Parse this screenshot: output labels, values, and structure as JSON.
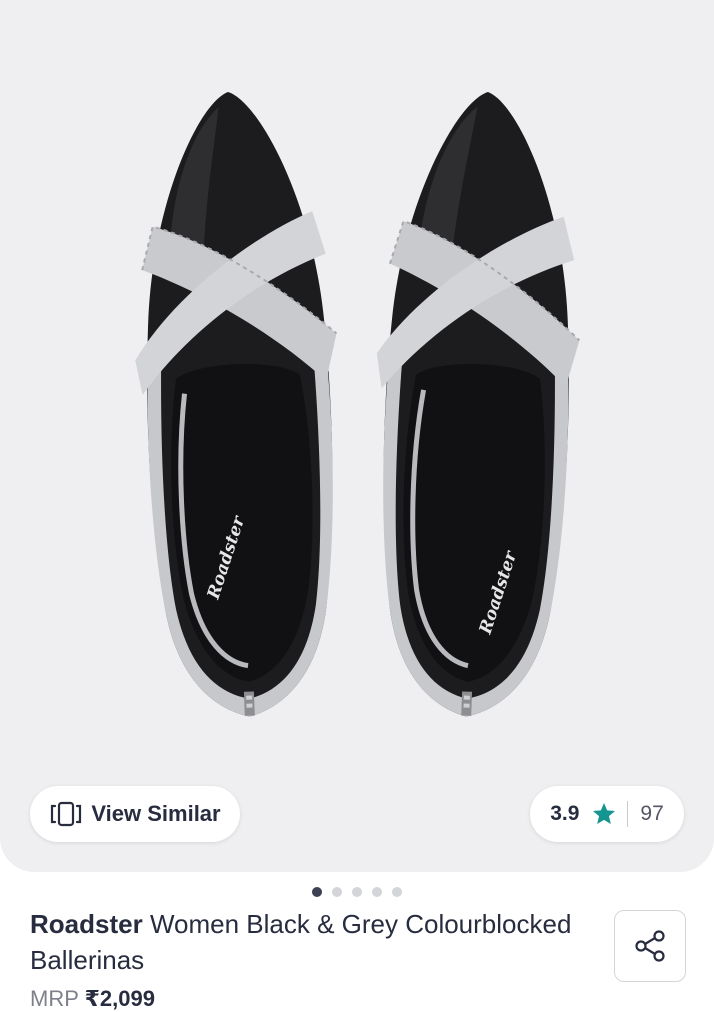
{
  "product_image": {
    "carousel_total": 5,
    "carousel_active_index": 0,
    "logo_text": "Roadster"
  },
  "view_similar": {
    "label": "View Similar",
    "icon": "similar-icon"
  },
  "rating": {
    "value": "3.9",
    "count": "97",
    "star_color": "#14958f"
  },
  "product": {
    "brand": "Roadster",
    "name": "Women Black & Grey Colourblocked Ballerinas"
  },
  "price": {
    "mrp_label": "MRP",
    "amount": "₹2,099"
  },
  "share": {
    "icon": "share-icon"
  }
}
